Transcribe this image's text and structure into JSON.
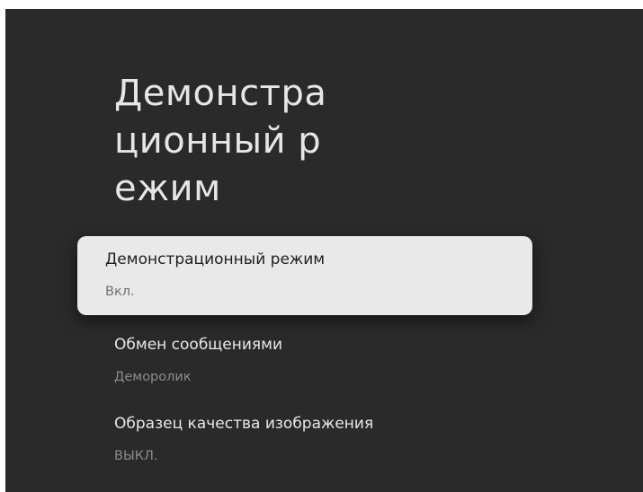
{
  "page": {
    "title": "Демонстрационный режим"
  },
  "menu": {
    "items": [
      {
        "label": "Демонстрационный режим",
        "value": "Вкл."
      },
      {
        "label": "Обмен сообщениями",
        "value": "Деморолик"
      },
      {
        "label": "Образец качества изображения",
        "value": "ВЫКЛ."
      }
    ]
  },
  "colors": {
    "background": "#2a2a2a",
    "focused_item": "#e9e9e9",
    "text_primary": "#e8e8e8",
    "text_secondary": "#8c8c8c"
  }
}
